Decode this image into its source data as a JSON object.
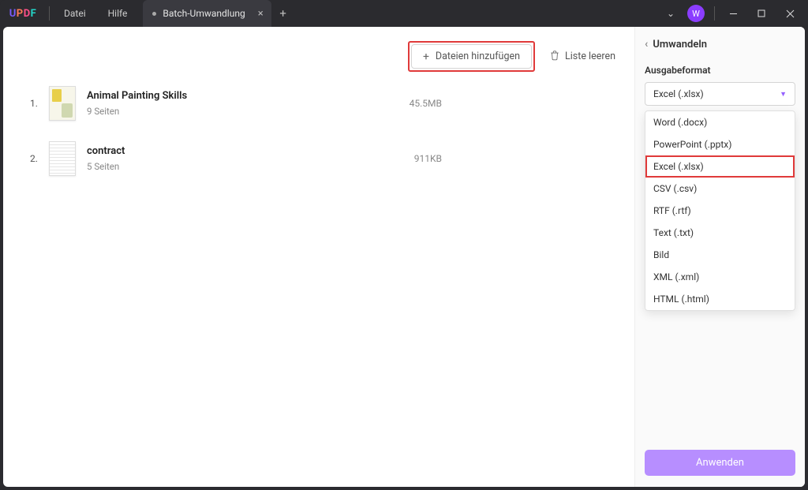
{
  "titlebar": {
    "logo_letters": {
      "u": "U",
      "p": "P",
      "d": "D",
      "f": "F"
    },
    "menu_file": "Datei",
    "menu_help": "Hilfe",
    "tab_label": "Batch-Umwandlung",
    "avatar_initial": "W"
  },
  "toolbar": {
    "add_files": "Dateien hinzufügen",
    "clear_list": "Liste leeren"
  },
  "files": [
    {
      "idx": "1.",
      "name": "Animal Painting Skills",
      "pages": "9 Seiten",
      "size": "45.5MB"
    },
    {
      "idx": "2.",
      "name": "contract",
      "pages": "5 Seiten",
      "size": "911KB"
    }
  ],
  "sidebar": {
    "title": "Umwandeln",
    "format_label": "Ausgabeformat",
    "selected": "Excel (.xlsx)",
    "options": [
      "Word (.docx)",
      "PowerPoint (.pptx)",
      "Excel (.xlsx)",
      "CSV (.csv)",
      "RTF (.rtf)",
      "Text (.txt)",
      "Bild",
      "XML (.xml)",
      "HTML (.html)"
    ],
    "apply": "Anwenden"
  }
}
